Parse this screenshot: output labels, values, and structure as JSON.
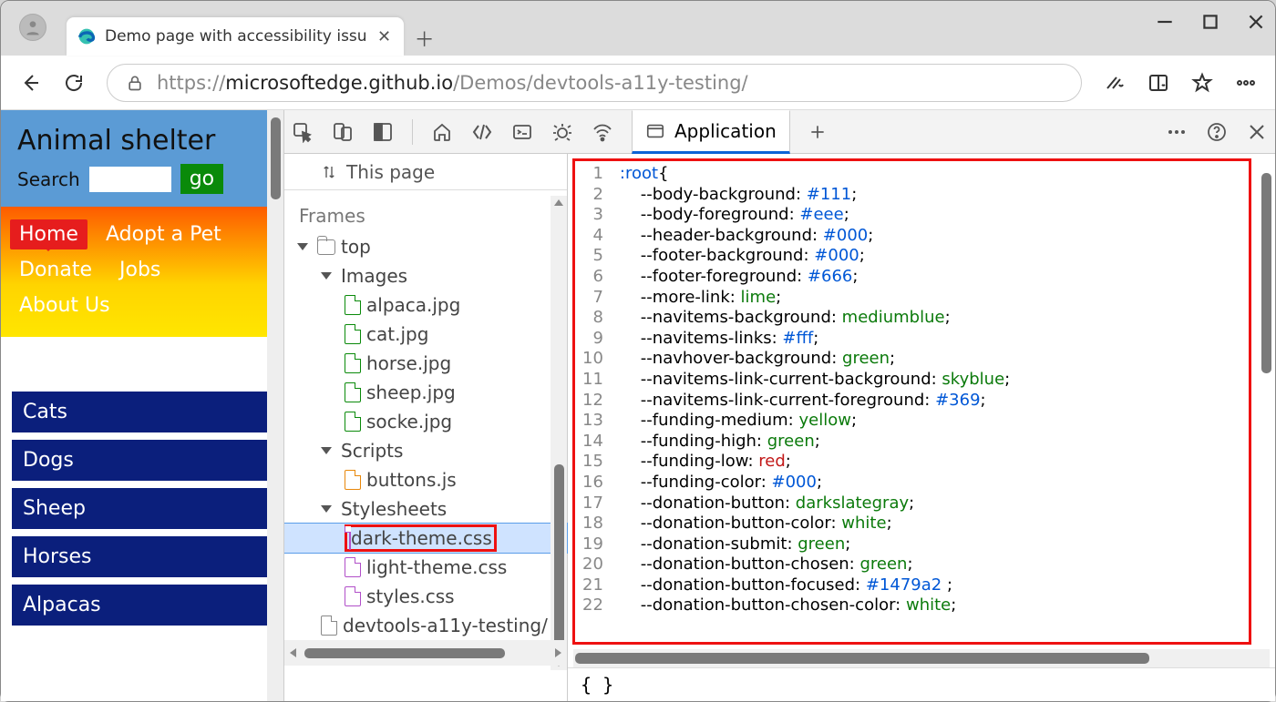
{
  "tab": {
    "title": "Demo page with accessibility issu"
  },
  "url": {
    "prefix": "https://",
    "domain": "microsoftedge.github.io",
    "path": "/Demos/devtools-a11y-testing/"
  },
  "page": {
    "title": "Animal shelter",
    "searchLabel": "Search",
    "goLabel": "go",
    "nav": [
      "Home",
      "Adopt a Pet",
      "Donate",
      "Jobs",
      "About Us"
    ],
    "list": [
      "Cats",
      "Dogs",
      "Sheep",
      "Horses",
      "Alpacas"
    ]
  },
  "dt": {
    "thisPage": "This page",
    "framesHeading": "Frames",
    "appTab": "Application",
    "tree": {
      "top": "top",
      "images": "Images",
      "imageFiles": [
        "alpaca.jpg",
        "cat.jpg",
        "horse.jpg",
        "sheep.jpg",
        "socke.jpg"
      ],
      "scripts": "Scripts",
      "scriptFiles": [
        "buttons.js"
      ],
      "stylesheets": "Stylesheets",
      "cssFiles": [
        "dark-theme.css",
        "light-theme.css",
        "styles.css"
      ],
      "doc": "devtools-a11y-testing/"
    },
    "brace": "{ }",
    "code": [
      {
        "n": 1,
        "t": ":root",
        "c": "k-root",
        "s": "{"
      },
      {
        "n": 2,
        "p": "    --body-background: ",
        "v": "#111",
        "c": "k-hex",
        "s": ";"
      },
      {
        "n": 3,
        "p": "    --body-foreground: ",
        "v": "#eee",
        "c": "k-hex",
        "s": ";"
      },
      {
        "n": 4,
        "p": "    --header-background: ",
        "v": "#000",
        "c": "k-hex",
        "s": ";"
      },
      {
        "n": 5,
        "p": "    --footer-background: ",
        "v": "#000",
        "c": "k-hex",
        "s": ";"
      },
      {
        "n": 6,
        "p": "    --footer-foreground: ",
        "v": "#666",
        "c": "k-hex",
        "s": ";"
      },
      {
        "n": 7,
        "p": "    --more-link: ",
        "v": "lime",
        "c": "k-kw",
        "s": ";"
      },
      {
        "n": 8,
        "p": "    --navitems-background: ",
        "v": "mediumblue",
        "c": "k-kw",
        "s": ";"
      },
      {
        "n": 9,
        "p": "    --navitems-links: ",
        "v": "#fff",
        "c": "k-hex",
        "s": ";"
      },
      {
        "n": 10,
        "p": "    --navhover-background: ",
        "v": "green",
        "c": "k-kw",
        "s": ";"
      },
      {
        "n": 11,
        "p": "    --navitems-link-current-background: ",
        "v": "skyblue",
        "c": "k-kw",
        "s": ";"
      },
      {
        "n": 12,
        "p": "    --navitems-link-current-foreground: ",
        "v": "#369",
        "c": "k-hex",
        "s": ";"
      },
      {
        "n": 13,
        "p": "    --funding-medium: ",
        "v": "yellow",
        "c": "k-kw",
        "s": ";"
      },
      {
        "n": 14,
        "p": "    --funding-high: ",
        "v": "green",
        "c": "k-kw",
        "s": ";"
      },
      {
        "n": 15,
        "p": "    --funding-low: ",
        "v": "red",
        "c": "k-red",
        "s": ";"
      },
      {
        "n": 16,
        "p": "    --funding-color: ",
        "v": "#000",
        "c": "k-hex",
        "s": ";"
      },
      {
        "n": 17,
        "p": "    --donation-button: ",
        "v": "darkslategray",
        "c": "k-kw",
        "s": ";"
      },
      {
        "n": 18,
        "p": "    --donation-button-color: ",
        "v": "white",
        "c": "k-kw",
        "s": ";"
      },
      {
        "n": 19,
        "p": "    --donation-submit: ",
        "v": "green",
        "c": "k-kw",
        "s": ";"
      },
      {
        "n": 20,
        "p": "    --donation-button-chosen: ",
        "v": "green",
        "c": "k-kw",
        "s": ";"
      },
      {
        "n": 21,
        "p": "    --donation-button-focused: ",
        "v": "#1479a2 ",
        "c": "k-hex",
        "s": ";"
      },
      {
        "n": 22,
        "p": "    --donation-button-chosen-color: ",
        "v": "white",
        "c": "k-kw",
        "s": ";"
      }
    ]
  }
}
